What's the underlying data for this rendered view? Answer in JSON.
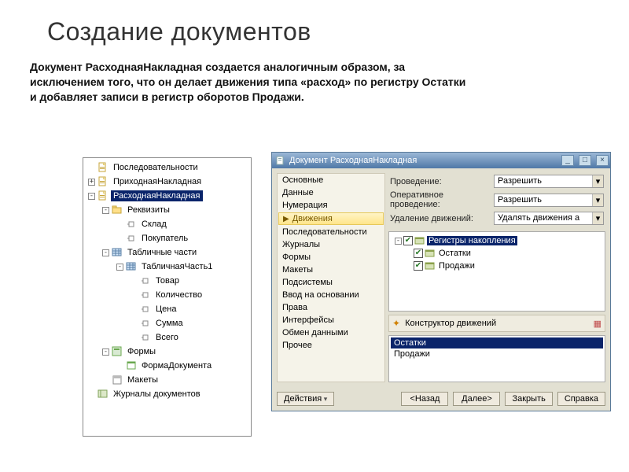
{
  "slide": {
    "title": "Создание документов",
    "text": "Документ РасходнаяНакладная создается аналогичным образом, за исключением того, что он делает движения типа «расход» по регистру Остатки и добавляет записи в регистр оборотов Продажи."
  },
  "tree": {
    "items": [
      {
        "label": "Последовательности",
        "indent": 1,
        "exp": "",
        "icon": "doc"
      },
      {
        "label": "ПриходнаяНакладная",
        "indent": 1,
        "exp": "+",
        "icon": "doc"
      },
      {
        "label": "РасходнаяНакладная",
        "indent": 1,
        "exp": "-",
        "icon": "doc",
        "selected": true
      },
      {
        "label": "Реквизиты",
        "indent": 2,
        "exp": "-",
        "icon": "folder"
      },
      {
        "label": "Склад",
        "indent": 3,
        "exp": "",
        "icon": "attr"
      },
      {
        "label": "Покупатель",
        "indent": 3,
        "exp": "",
        "icon": "attr"
      },
      {
        "label": "Табличные части",
        "indent": 2,
        "exp": "-",
        "icon": "grid"
      },
      {
        "label": "ТабличнаяЧасть1",
        "indent": 3,
        "exp": "-",
        "icon": "grid"
      },
      {
        "label": "Товар",
        "indent": 4,
        "exp": "",
        "icon": "attr"
      },
      {
        "label": "Количество",
        "indent": 4,
        "exp": "",
        "icon": "attr"
      },
      {
        "label": "Цена",
        "indent": 4,
        "exp": "",
        "icon": "attr"
      },
      {
        "label": "Сумма",
        "indent": 4,
        "exp": "",
        "icon": "attr"
      },
      {
        "label": "Всего",
        "indent": 4,
        "exp": "",
        "icon": "attr"
      },
      {
        "label": "Формы",
        "indent": 2,
        "exp": "-",
        "icon": "forms"
      },
      {
        "label": "ФормаДокумента",
        "indent": 3,
        "exp": "",
        "icon": "form"
      },
      {
        "label": "Макеты",
        "indent": 2,
        "exp": "",
        "icon": "tmpl"
      },
      {
        "label": "Журналы документов",
        "indent": 1,
        "exp": "",
        "icon": "journal"
      }
    ]
  },
  "dialog": {
    "title": "Документ РасходнаяНакладная",
    "nav": {
      "items": [
        "Основные",
        "Данные",
        "Нумерация"
      ],
      "selected": "Движения",
      "rest": [
        "Последовательности",
        "Журналы",
        "Формы",
        "Макеты",
        "Подсистемы",
        "Ввод на основании",
        "Права",
        "Интерфейсы",
        "Обмен данными",
        "Прочее"
      ]
    },
    "form": {
      "rows": [
        {
          "label": "Проведение:",
          "value": "Разрешить"
        },
        {
          "label": "Оперативное проведение:",
          "value": "Разрешить"
        },
        {
          "label": "Удаление движений:",
          "value": "Удалять движения а"
        }
      ]
    },
    "regtree": {
      "root": "Регистры накопления",
      "children": [
        {
          "label": "Остатки",
          "checked": true
        },
        {
          "label": "Продажи",
          "checked": true
        }
      ]
    },
    "constructor_label": "Конструктор движений",
    "selected_list": [
      "Остатки",
      "Продажи"
    ],
    "selected_list_sel": "Остатки",
    "buttons": {
      "actions": "Действия",
      "back": "<Назад",
      "next": "Далее>",
      "close": "Закрыть",
      "help": "Справка"
    }
  }
}
